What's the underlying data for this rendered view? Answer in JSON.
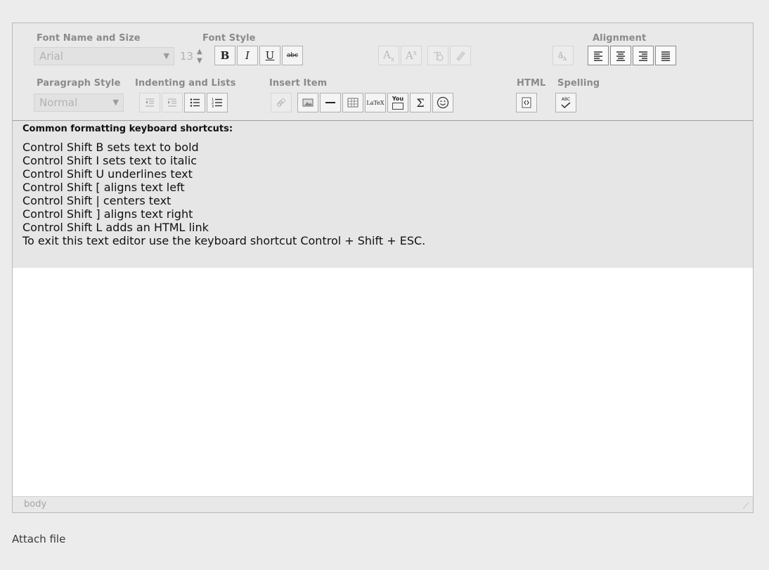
{
  "toolbar": {
    "groups": {
      "font_name_size": "Font Name and Size",
      "font_style": "Font Style",
      "alignment": "Alignment",
      "paragraph_style": "Paragraph Style",
      "indenting_lists": "Indenting and Lists",
      "insert_item": "Insert Item",
      "html": "HTML",
      "spelling": "Spelling"
    },
    "font_name": "Arial",
    "font_size": "13",
    "paragraph_style": "Normal",
    "font_style_buttons": {
      "bold": "B",
      "italic": "I",
      "underline": "U",
      "strike": "abc"
    },
    "script_buttons": {
      "subscript": "A",
      "superscript": "A",
      "sub_mark": "x",
      "sup_mark": "x"
    },
    "insert_labels": {
      "latex": "LaTeX",
      "youtube": "You",
      "sigma": "Σ"
    },
    "spell_label": "ABC"
  },
  "content": {
    "heading": "Common formatting keyboard shortcuts:",
    "lines": [
      "Control Shift B sets text to bold",
      "Control Shift I sets text to italic",
      "Control Shift U underlines text",
      "Control Shift [ aligns text left",
      "Control Shift | centers text",
      "Control Shift ] aligns text right",
      "Control Shift L adds an HTML link",
      "To exit this text editor use the keyboard shortcut Control + Shift + ESC."
    ]
  },
  "statusbar": {
    "path": "body"
  },
  "attach_label": "Attach file"
}
